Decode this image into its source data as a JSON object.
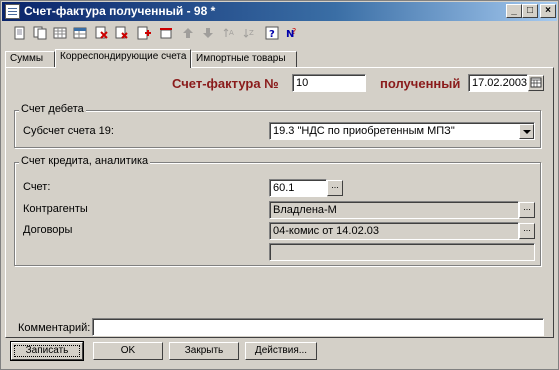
{
  "window": {
    "title": "Счет-фактура полученный - 98 *",
    "controls": {
      "minimize": "_",
      "maximize": "□",
      "close": "×"
    }
  },
  "toolbar": {
    "icons": [
      "new-doc-icon",
      "copy-doc-icon",
      "grid-icon",
      "table-icon",
      "delete-icon",
      "cut-delete-icon",
      "add-row-icon",
      "insert-row-icon",
      "arrow-up-icon",
      "arrow-down-icon",
      "sort-asc-icon",
      "sort-desc-icon",
      "help-icon",
      "check-help-icon"
    ]
  },
  "tabs": [
    {
      "label": "Суммы",
      "active": false
    },
    {
      "label": "Корреспондирующие счета",
      "active": true
    },
    {
      "label": "Импортные товары",
      "active": false
    }
  ],
  "header": {
    "invoice_label": "Счет-фактура №",
    "invoice_number": "10",
    "received_label": "полученный",
    "date": "17.02.2003"
  },
  "debit": {
    "group_title": "Счет дебета",
    "subaccount_label": "Субсчет счета 19:",
    "subaccount_value": "19.3 \"НДС по приобретенным МПЗ\""
  },
  "credit": {
    "group_title": "Счет кредита, аналитика",
    "account_label": "Счет:",
    "account_value": "60.1",
    "contractors_label": "Контрагенты",
    "contractors_value": "Владлена-М",
    "contracts_label": "Договоры",
    "contracts_value": "04-комис от 14.02.03",
    "extra_value": ""
  },
  "comment": {
    "label": "Комментарий:",
    "value": ""
  },
  "buttons": {
    "save": "Записать",
    "ok": "OK",
    "close": "Закрыть",
    "actions": "Действия..."
  }
}
